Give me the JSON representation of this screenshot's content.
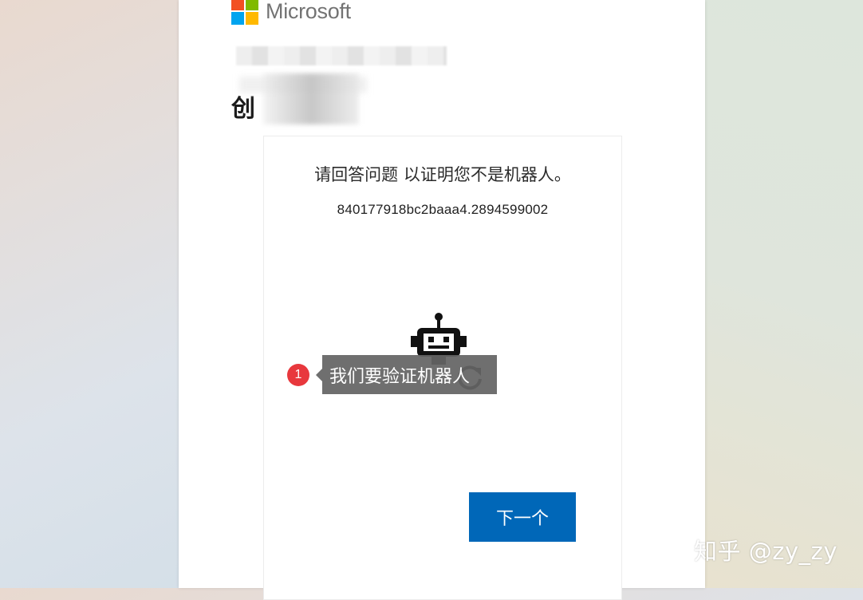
{
  "brand": {
    "name": "Microsoft",
    "logo_colors": [
      "#f25022",
      "#7fba00",
      "#00a4ef",
      "#ffb900"
    ]
  },
  "header": {
    "heading_visible": "创"
  },
  "puzzle": {
    "prompt": "请回答问题 以证明您不是机器人。",
    "session_id": "840177918bc2baaa4.2894599002",
    "robot_icon": "robot-icon",
    "refresh_icon": "refresh-icon"
  },
  "buttons": {
    "next_label": "下一个",
    "next_color": "#0067b8"
  },
  "annotation": {
    "step_number": "1",
    "tooltip": "我们要验证机器人",
    "badge_color": "#e8383d"
  },
  "watermark": "知乎 @zy_zy"
}
